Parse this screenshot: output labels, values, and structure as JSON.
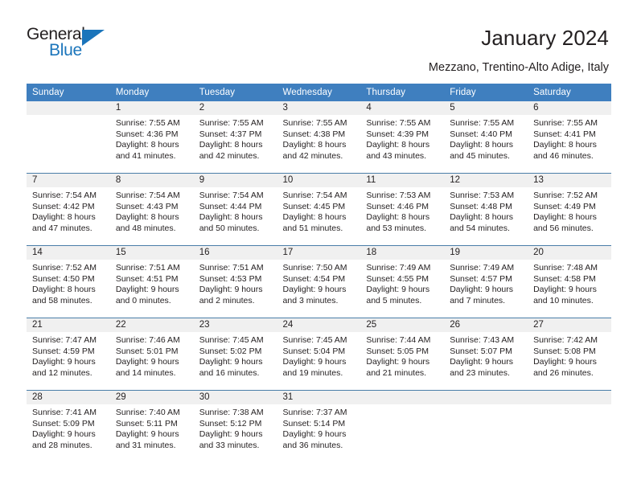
{
  "brand": {
    "name_top": "General",
    "name_bottom": "Blue",
    "accent_color": "#1b75bb",
    "triangle_icon": "triangle-icon"
  },
  "header": {
    "title": "January 2024",
    "subtitle": "Mezzano, Trentino-Alto Adige, Italy"
  },
  "calendar": {
    "header_bg": "#3f7fbf",
    "daynum_band_bg": "#f0f0f0",
    "weekday_headers": [
      "Sunday",
      "Monday",
      "Tuesday",
      "Wednesday",
      "Thursday",
      "Friday",
      "Saturday"
    ],
    "weeks": [
      [
        {
          "day": "",
          "sunrise": "",
          "sunset": "",
          "daylight_line1": "",
          "daylight_line2": ""
        },
        {
          "day": "1",
          "sunrise": "Sunrise: 7:55 AM",
          "sunset": "Sunset: 4:36 PM",
          "daylight_line1": "Daylight: 8 hours",
          "daylight_line2": "and 41 minutes."
        },
        {
          "day": "2",
          "sunrise": "Sunrise: 7:55 AM",
          "sunset": "Sunset: 4:37 PM",
          "daylight_line1": "Daylight: 8 hours",
          "daylight_line2": "and 42 minutes."
        },
        {
          "day": "3",
          "sunrise": "Sunrise: 7:55 AM",
          "sunset": "Sunset: 4:38 PM",
          "daylight_line1": "Daylight: 8 hours",
          "daylight_line2": "and 42 minutes."
        },
        {
          "day": "4",
          "sunrise": "Sunrise: 7:55 AM",
          "sunset": "Sunset: 4:39 PM",
          "daylight_line1": "Daylight: 8 hours",
          "daylight_line2": "and 43 minutes."
        },
        {
          "day": "5",
          "sunrise": "Sunrise: 7:55 AM",
          "sunset": "Sunset: 4:40 PM",
          "daylight_line1": "Daylight: 8 hours",
          "daylight_line2": "and 45 minutes."
        },
        {
          "day": "6",
          "sunrise": "Sunrise: 7:55 AM",
          "sunset": "Sunset: 4:41 PM",
          "daylight_line1": "Daylight: 8 hours",
          "daylight_line2": "and 46 minutes."
        }
      ],
      [
        {
          "day": "7",
          "sunrise": "Sunrise: 7:54 AM",
          "sunset": "Sunset: 4:42 PM",
          "daylight_line1": "Daylight: 8 hours",
          "daylight_line2": "and 47 minutes."
        },
        {
          "day": "8",
          "sunrise": "Sunrise: 7:54 AM",
          "sunset": "Sunset: 4:43 PM",
          "daylight_line1": "Daylight: 8 hours",
          "daylight_line2": "and 48 minutes."
        },
        {
          "day": "9",
          "sunrise": "Sunrise: 7:54 AM",
          "sunset": "Sunset: 4:44 PM",
          "daylight_line1": "Daylight: 8 hours",
          "daylight_line2": "and 50 minutes."
        },
        {
          "day": "10",
          "sunrise": "Sunrise: 7:54 AM",
          "sunset": "Sunset: 4:45 PM",
          "daylight_line1": "Daylight: 8 hours",
          "daylight_line2": "and 51 minutes."
        },
        {
          "day": "11",
          "sunrise": "Sunrise: 7:53 AM",
          "sunset": "Sunset: 4:46 PM",
          "daylight_line1": "Daylight: 8 hours",
          "daylight_line2": "and 53 minutes."
        },
        {
          "day": "12",
          "sunrise": "Sunrise: 7:53 AM",
          "sunset": "Sunset: 4:48 PM",
          "daylight_line1": "Daylight: 8 hours",
          "daylight_line2": "and 54 minutes."
        },
        {
          "day": "13",
          "sunrise": "Sunrise: 7:52 AM",
          "sunset": "Sunset: 4:49 PM",
          "daylight_line1": "Daylight: 8 hours",
          "daylight_line2": "and 56 minutes."
        }
      ],
      [
        {
          "day": "14",
          "sunrise": "Sunrise: 7:52 AM",
          "sunset": "Sunset: 4:50 PM",
          "daylight_line1": "Daylight: 8 hours",
          "daylight_line2": "and 58 minutes."
        },
        {
          "day": "15",
          "sunrise": "Sunrise: 7:51 AM",
          "sunset": "Sunset: 4:51 PM",
          "daylight_line1": "Daylight: 9 hours",
          "daylight_line2": "and 0 minutes."
        },
        {
          "day": "16",
          "sunrise": "Sunrise: 7:51 AM",
          "sunset": "Sunset: 4:53 PM",
          "daylight_line1": "Daylight: 9 hours",
          "daylight_line2": "and 2 minutes."
        },
        {
          "day": "17",
          "sunrise": "Sunrise: 7:50 AM",
          "sunset": "Sunset: 4:54 PM",
          "daylight_line1": "Daylight: 9 hours",
          "daylight_line2": "and 3 minutes."
        },
        {
          "day": "18",
          "sunrise": "Sunrise: 7:49 AM",
          "sunset": "Sunset: 4:55 PM",
          "daylight_line1": "Daylight: 9 hours",
          "daylight_line2": "and 5 minutes."
        },
        {
          "day": "19",
          "sunrise": "Sunrise: 7:49 AM",
          "sunset": "Sunset: 4:57 PM",
          "daylight_line1": "Daylight: 9 hours",
          "daylight_line2": "and 7 minutes."
        },
        {
          "day": "20",
          "sunrise": "Sunrise: 7:48 AM",
          "sunset": "Sunset: 4:58 PM",
          "daylight_line1": "Daylight: 9 hours",
          "daylight_line2": "and 10 minutes."
        }
      ],
      [
        {
          "day": "21",
          "sunrise": "Sunrise: 7:47 AM",
          "sunset": "Sunset: 4:59 PM",
          "daylight_line1": "Daylight: 9 hours",
          "daylight_line2": "and 12 minutes."
        },
        {
          "day": "22",
          "sunrise": "Sunrise: 7:46 AM",
          "sunset": "Sunset: 5:01 PM",
          "daylight_line1": "Daylight: 9 hours",
          "daylight_line2": "and 14 minutes."
        },
        {
          "day": "23",
          "sunrise": "Sunrise: 7:45 AM",
          "sunset": "Sunset: 5:02 PM",
          "daylight_line1": "Daylight: 9 hours",
          "daylight_line2": "and 16 minutes."
        },
        {
          "day": "24",
          "sunrise": "Sunrise: 7:45 AM",
          "sunset": "Sunset: 5:04 PM",
          "daylight_line1": "Daylight: 9 hours",
          "daylight_line2": "and 19 minutes."
        },
        {
          "day": "25",
          "sunrise": "Sunrise: 7:44 AM",
          "sunset": "Sunset: 5:05 PM",
          "daylight_line1": "Daylight: 9 hours",
          "daylight_line2": "and 21 minutes."
        },
        {
          "day": "26",
          "sunrise": "Sunrise: 7:43 AM",
          "sunset": "Sunset: 5:07 PM",
          "daylight_line1": "Daylight: 9 hours",
          "daylight_line2": "and 23 minutes."
        },
        {
          "day": "27",
          "sunrise": "Sunrise: 7:42 AM",
          "sunset": "Sunset: 5:08 PM",
          "daylight_line1": "Daylight: 9 hours",
          "daylight_line2": "and 26 minutes."
        }
      ],
      [
        {
          "day": "28",
          "sunrise": "Sunrise: 7:41 AM",
          "sunset": "Sunset: 5:09 PM",
          "daylight_line1": "Daylight: 9 hours",
          "daylight_line2": "and 28 minutes."
        },
        {
          "day": "29",
          "sunrise": "Sunrise: 7:40 AM",
          "sunset": "Sunset: 5:11 PM",
          "daylight_line1": "Daylight: 9 hours",
          "daylight_line2": "and 31 minutes."
        },
        {
          "day": "30",
          "sunrise": "Sunrise: 7:38 AM",
          "sunset": "Sunset: 5:12 PM",
          "daylight_line1": "Daylight: 9 hours",
          "daylight_line2": "and 33 minutes."
        },
        {
          "day": "31",
          "sunrise": "Sunrise: 7:37 AM",
          "sunset": "Sunset: 5:14 PM",
          "daylight_line1": "Daylight: 9 hours",
          "daylight_line2": "and 36 minutes."
        },
        {
          "day": "",
          "sunrise": "",
          "sunset": "",
          "daylight_line1": "",
          "daylight_line2": ""
        },
        {
          "day": "",
          "sunrise": "",
          "sunset": "",
          "daylight_line1": "",
          "daylight_line2": ""
        },
        {
          "day": "",
          "sunrise": "",
          "sunset": "",
          "daylight_line1": "",
          "daylight_line2": ""
        }
      ]
    ]
  }
}
